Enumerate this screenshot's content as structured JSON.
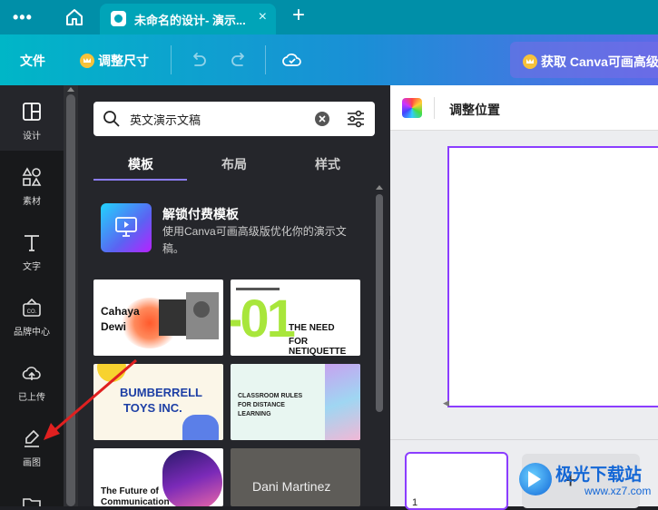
{
  "browser": {
    "tab_title": "未命名的设计- 演示...",
    "tab_close": "×",
    "new_tab": "+",
    "more": "•••"
  },
  "toolbar": {
    "file": "文件",
    "resize": "调整尺寸",
    "upgrade": "获取 Canva可画高级",
    "accent_color": "#f7c23a"
  },
  "rail": {
    "items": [
      {
        "label": "设计",
        "icon": "design-icon"
      },
      {
        "label": "素材",
        "icon": "elements-icon"
      },
      {
        "label": "文字",
        "icon": "text-icon"
      },
      {
        "label": "品牌中心",
        "icon": "brand-icon"
      },
      {
        "label": "已上传",
        "icon": "upload-icon"
      },
      {
        "label": "画图",
        "icon": "draw-icon"
      }
    ]
  },
  "panel": {
    "search_value": "英文演示文稿",
    "tabs": [
      "模板",
      "布局",
      "样式"
    ],
    "promo_title": "解锁付费模板",
    "promo_desc": "使用Canva可画高级版优化你的演示文稿。",
    "templates": [
      {
        "title_line1": "Cahaya",
        "title_line2": "Dewi"
      },
      {
        "number": "-01",
        "line1": "THE NEED",
        "line2": "FOR NETIQUETTE"
      },
      {
        "line1": "BUMBERRELL",
        "line2": "TOYS INC."
      },
      {
        "line1": "CLASSROOM RULES",
        "line2": "FOR DISTANCE",
        "line3": "LEARNING"
      },
      {
        "line1": "The Future of",
        "line2": "Communication"
      },
      {
        "line1": "Dani Martinez"
      }
    ]
  },
  "editor": {
    "position_label": "调整位置",
    "page_number": "1",
    "add_page": "+"
  },
  "watermark": {
    "title": "极光下载站",
    "url": "www.xz7.com"
  },
  "colors": {
    "accent": "#8b3dff",
    "annotation_arrow": "#e02020"
  }
}
